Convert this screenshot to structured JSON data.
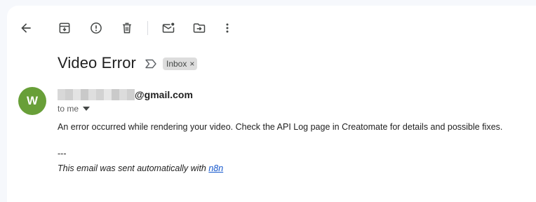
{
  "toolbar": {
    "buttons": [
      {
        "name": "back-button",
        "icon": "arrow-left-icon"
      },
      {
        "name": "archive-button",
        "icon": "archive-icon"
      },
      {
        "name": "report-spam-button",
        "icon": "report-icon"
      },
      {
        "name": "delete-button",
        "icon": "trash-icon"
      },
      {
        "name": "mark-unread-button",
        "icon": "mark-unread-icon"
      },
      {
        "name": "move-to-button",
        "icon": "move-to-folder-icon"
      },
      {
        "name": "more-button",
        "icon": "more-vert-icon"
      }
    ]
  },
  "email": {
    "subject": "Video Error",
    "label": "Inbox",
    "label_remove": "×",
    "sender_initial": "W",
    "sender_domain": "@gmail.com",
    "recipient": "to me",
    "body": "An error occurred while rendering your video. Check the API Log page in Creatomate for details and possible fixes.",
    "signature_separator": "---",
    "signature_prefix": "This email was sent automatically with ",
    "signature_link": "n8n"
  },
  "colors": {
    "avatar": "#689f38",
    "link": "#1155cc",
    "chip_bg": "#dddddd",
    "page_bg": "#f6f8fc"
  }
}
